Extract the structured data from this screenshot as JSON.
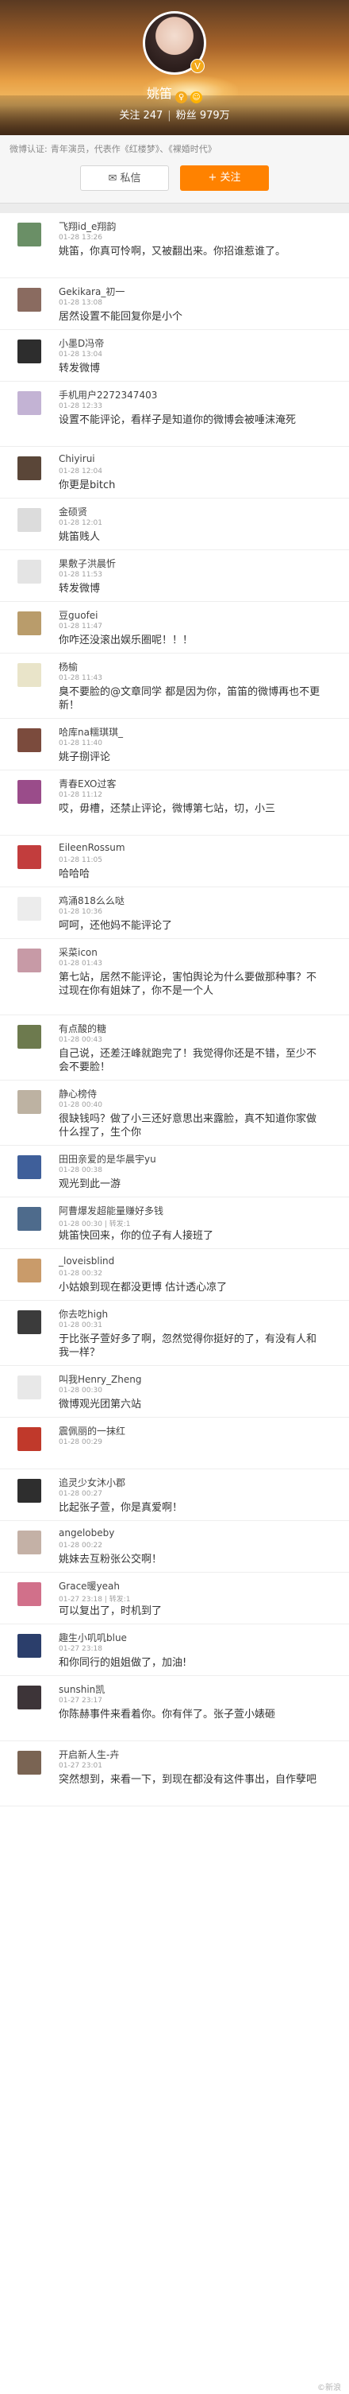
{
  "profile": {
    "name": "姚笛",
    "follow_label": "关注",
    "follow_count": "247",
    "fans_label": "粉丝",
    "fans_count": "979万",
    "verify_label": "微博认证:",
    "verify_text": "青年演员，代表作《红楼梦》、《裸婚时代》",
    "message_button": "私信",
    "follow_button": "+ 关注"
  },
  "comments": [
    {
      "user": "飞翔id_e翔韵",
      "time": "01-28 13:26",
      "text": "姚笛，你真可怜啊，又被翻出来。你招谁惹谁了。",
      "lines": 2,
      "color": "#6a8f66"
    },
    {
      "user": "Gekikara_初一",
      "time": "01-28 13:08",
      "text": "居然设置不能回复你是小个",
      "lines": 1,
      "color": "#8a6b60"
    },
    {
      "user": "小墨D冯帝",
      "time": "01-28 13:04",
      "text": "转发微博",
      "lines": 1,
      "color": "#2d2d2d"
    },
    {
      "user": "手机用户2272347403",
      "time": "01-28 12:33",
      "text": "设置不能评论，看样子是知道你的微博会被唾沫淹死",
      "lines": 2,
      "color": "#c3b3d4"
    },
    {
      "user": "Chiyirui",
      "time": "01-28 12:04",
      "text": "你更是bitch",
      "lines": 1,
      "color": "#5a4638"
    },
    {
      "user": "金硕贤",
      "time": "01-28 12:01",
      "text": "姚笛贱人",
      "lines": 1,
      "color": "#dcdcdc"
    },
    {
      "user": "果敷子洪晨忻",
      "time": "01-28 11:53",
      "text": "转发微博",
      "lines": 1,
      "color": "#e4e4e4"
    },
    {
      "user": "豆guofei",
      "time": "01-28 11:47",
      "text": "你咋还没滚出娱乐圈呢！！！",
      "lines": 1,
      "color": "#b99c6b"
    },
    {
      "user": "杨榆",
      "time": "01-28 11:43",
      "text": "臭不要脸的@文章同学 都是因为你，笛笛的微博再也不更新！",
      "lines": 2,
      "color": "#e9e4c9"
    },
    {
      "user": "哈库na糯琪琪_",
      "time": "01-28 11:40",
      "text": "姚子捌评论",
      "lines": 1,
      "color": "#7b4b3d"
    },
    {
      "user": "青春EXO过客",
      "time": "01-28 11:12",
      "text": "哎，毋槽，还禁止评论，微博第七站，切，小三",
      "lines": 2,
      "color": "#9a4c8a"
    },
    {
      "user": "EileenRossum",
      "time": "01-28 11:05",
      "text": "哈哈哈",
      "lines": 1,
      "color": "#c23d3d"
    },
    {
      "user": "鸡涌818么么哒",
      "time": "01-28 10:36",
      "text": "呵呵，还他妈不能评论了",
      "lines": 1,
      "color": "#ececec"
    },
    {
      "user": "采菜icon",
      "time": "01-28 01:43",
      "text": "第七站，居然不能评论，害怕舆论为什么要做那种事？不过现在你有姐妹了，你不是一个人",
      "lines": 3,
      "color": "#c79aa6"
    },
    {
      "user": "有点酸的糖",
      "time": "01-28 00:43",
      "text": "自己说，还差汪峰就跑完了！我觉得你还是不错，至少不会不要脸！",
      "lines": 2,
      "color": "#6d7a4e"
    },
    {
      "user": "静心榜侍",
      "time": "01-28 00:40",
      "text": "很缺钱吗？做了小三还好意思出来露脸，真不知道你家做什么捏了，生个你",
      "lines": 2,
      "color": "#bdb2a2"
    },
    {
      "user": "田田亲爱的是华晨宇yu",
      "time": "01-28 00:38",
      "text": "观光到此一游",
      "lines": 1,
      "color": "#3f5f9a"
    },
    {
      "user": "阿曹爆发超能量赚好多钱",
      "time": "01-28 00:30 | 转发:1",
      "text": "姚笛快回来，你的位子有人接班了",
      "lines": 1,
      "color": "#4e6b8c"
    },
    {
      "user": "_loveisblind",
      "time": "01-28 00:32",
      "text": "小姑娘到现在都没更博 估计透心凉了",
      "lines": 1,
      "color": "#c99b6a"
    },
    {
      "user": "你去吃high",
      "time": "01-28 00:31",
      "text": "于比张子萱好多了啊，忽然觉得你挺好的了，有没有人和我一样？",
      "lines": 2,
      "color": "#3b3b3b"
    },
    {
      "user": "叫我Henry_Zheng",
      "time": "01-28 00:30",
      "text": "微博观光团第六站",
      "lines": 1,
      "color": "#e8e8e8"
    },
    {
      "user": "震佩丽的一抹红",
      "time": "01-28 00:29",
      "text": "",
      "lines": 1,
      "color": "#c0392b"
    },
    {
      "user": "追灵少女沐小郡",
      "time": "01-28 00:27",
      "text": "比起张子萱，你是真爱啊！",
      "lines": 1,
      "color": "#2e2e2e"
    },
    {
      "user": "angelobeby",
      "time": "01-28 00:22",
      "text": "姚妹去互粉张公交啊！",
      "lines": 1,
      "color": "#c4b1a6"
    },
    {
      "user": "Grace暖yeah",
      "time": "01-27 23:18 | 转发:1",
      "text": "可以复出了，时机到了",
      "lines": 1,
      "color": "#d1708a"
    },
    {
      "user": "趣生小叽叽blue",
      "time": "01-27 23:18",
      "text": "和你同行的姐姐做了，加油!",
      "lines": 1,
      "color": "#2b3e6b"
    },
    {
      "user": "sunshin凯",
      "time": "01-27 23:17",
      "text": "你陈赫事件来看着你。你有伴了。张子萱小婊砸",
      "lines": 2,
      "color": "#3d3438"
    },
    {
      "user": "开启新人生-卉",
      "time": "01-27 23:01",
      "text": "突然想到，来看一下，到现在都没有这件事出，自作孽吧",
      "lines": 2,
      "color": "#7a6453"
    }
  ],
  "watermark": "©新浪"
}
